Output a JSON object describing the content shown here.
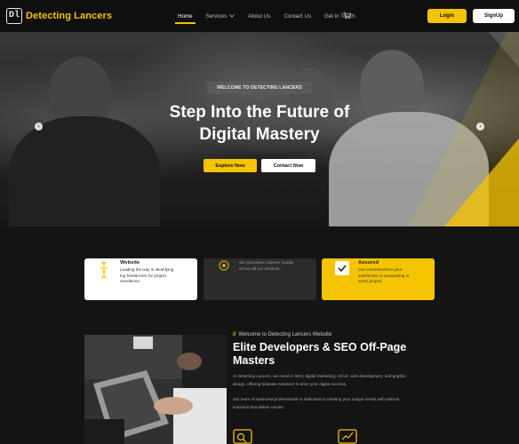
{
  "nav": {
    "logo_mark": "Dl",
    "brand": "Detecting Lancers",
    "items": [
      {
        "label": "Home",
        "active": true
      },
      {
        "label": "Services",
        "active": false
      },
      {
        "label": "About Us",
        "active": false
      },
      {
        "label": "Contact Us",
        "active": false
      },
      {
        "label": "Get in Touch",
        "active": false
      }
    ],
    "services_icon": "chevron-down-icon",
    "cart_icon": "cart-icon",
    "login_label": "Login",
    "signup_label": "SignUp"
  },
  "hero": {
    "tag": "WELCOME TO DETECTING LANCERS",
    "title_line1": "Step Into the Future of",
    "title_line2": "Digital Mastery",
    "explore_label": "Explore Now",
    "contact_label": "Contact Now",
    "prev_icon": "arrow-left-icon",
    "next_icon": "arrow-right-icon"
  },
  "cards": [
    {
      "title": "Website",
      "desc_lines": [
        "Leading the way in identifying",
        "top freelancers for project",
        "excellence."
      ],
      "icon": "trophy-icon"
    },
    {
      "title": "",
      "desc_lines": [
        "We guarantee superior quality",
        "across all our services."
      ],
      "icon": "medal-icon"
    },
    {
      "title": "Assured",
      "desc_lines": [
        "Our commitment to your",
        "satisfaction is unwavering in",
        "every project."
      ],
      "icon": "badge-icon"
    }
  ],
  "about": {
    "eyebrow": "Welcome to Detecting Lancers Website",
    "title_line1": "Elite Developers & SEO Off-Page",
    "title_line2": "Masters",
    "p1_lines": [
      "At Detecting Lancers, we excel in SEO, digital marketing, UI/UX, web development, and graphic",
      "design, offering bespoke solutions to drive your digital success."
    ],
    "p2_lines": [
      "Our team of seasoned professionals is dedicated to meeting your unique needs with tailored",
      "solutions that deliver results."
    ]
  },
  "colors": {
    "accent": "#f5c400",
    "background": "#141414",
    "card_dark": "#2b2b2b"
  }
}
